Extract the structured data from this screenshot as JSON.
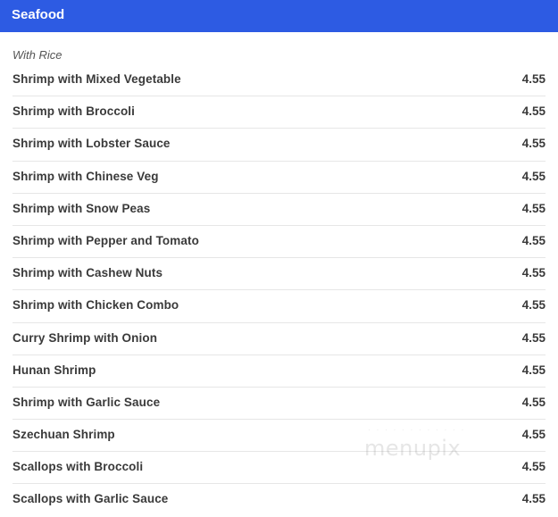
{
  "header": {
    "title": "Seafood"
  },
  "section": {
    "subtitle": "With Rice"
  },
  "items": [
    {
      "name": "Shrimp with Mixed Vegetable",
      "price": "4.55"
    },
    {
      "name": "Shrimp with Broccoli",
      "price": "4.55"
    },
    {
      "name": "Shrimp with Lobster Sauce",
      "price": "4.55"
    },
    {
      "name": "Shrimp with Chinese Veg",
      "price": "4.55"
    },
    {
      "name": "Shrimp with Snow Peas",
      "price": "4.55"
    },
    {
      "name": "Shrimp with Pepper and Tomato",
      "price": "4.55"
    },
    {
      "name": "Shrimp with Cashew Nuts",
      "price": "4.55"
    },
    {
      "name": "Shrimp with Chicken Combo",
      "price": "4.55"
    },
    {
      "name": "Curry Shrimp with Onion",
      "price": "4.55"
    },
    {
      "name": "Hunan Shrimp",
      "price": "4.55"
    },
    {
      "name": "Shrimp with Garlic Sauce",
      "price": "4.55"
    },
    {
      "name": "Szechuan Shrimp",
      "price": "4.55"
    },
    {
      "name": "Scallops with Broccoli",
      "price": "4.55"
    },
    {
      "name": "Scallops with Garlic Sauce",
      "price": "4.55"
    }
  ],
  "watermark": {
    "text": "menupix"
  },
  "colors": {
    "header_bg": "#2d5be3",
    "header_text": "#ffffff",
    "divider": "#e6e6e6"
  }
}
